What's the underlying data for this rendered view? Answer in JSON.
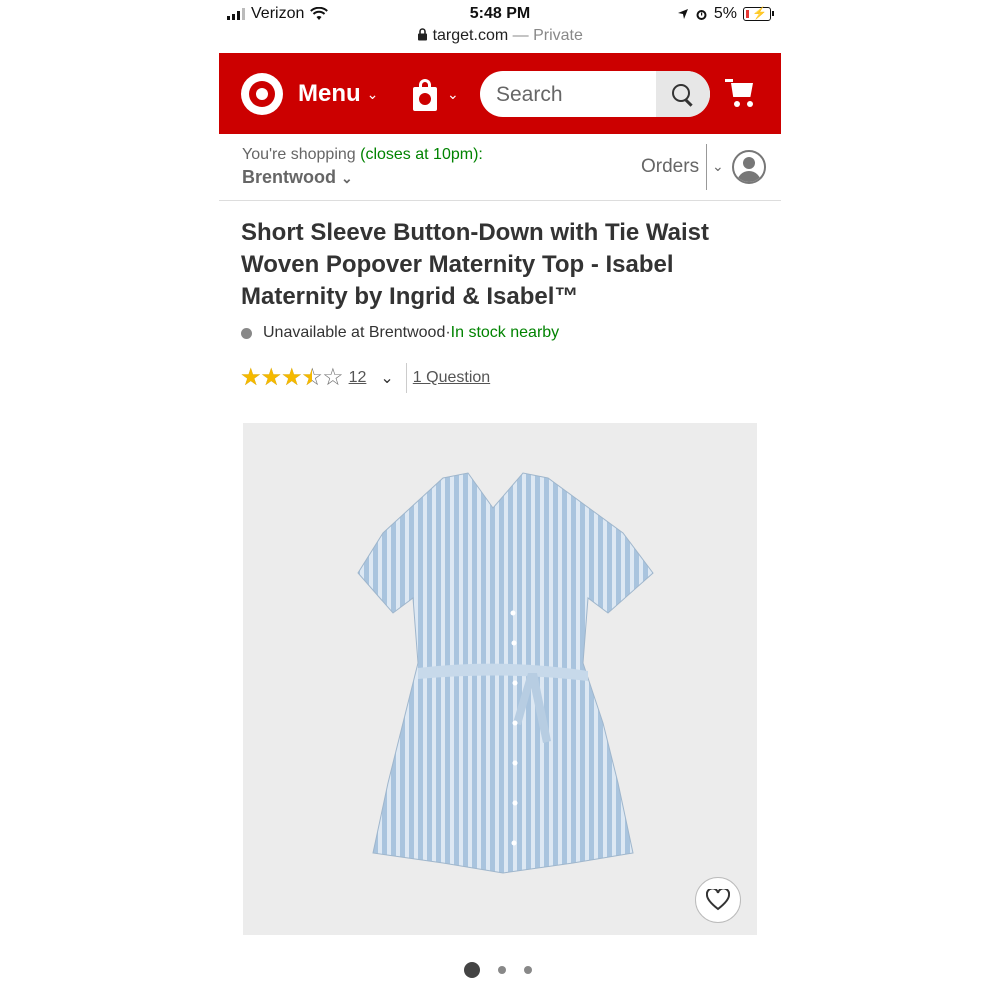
{
  "status_bar": {
    "carrier": "Verizon",
    "time": "5:48 PM",
    "battery": "5%",
    "url": "target.com",
    "private": "— Private"
  },
  "header": {
    "menu_label": "Menu",
    "search_placeholder": "Search",
    "brand_color": "#cc0000"
  },
  "shopping": {
    "prefix": "You're shopping ",
    "hours": "(closes at 10pm):",
    "store": "Brentwood",
    "orders_label": "Orders"
  },
  "product": {
    "title": "Short Sleeve Button-Down with Tie Waist Woven Popover Maternity Top - Isabel Maternity by Ingrid & Isabel™",
    "availability": "Unavailable at Brentwood",
    "separator": " · ",
    "stock_nearby": "In stock nearby",
    "rating": 3.5,
    "rating_max": 5,
    "review_count": "12",
    "questions_label": "1 Question"
  },
  "gallery": {
    "active_index": 0,
    "image_count": 3
  },
  "icons": [
    "signal-icon",
    "wifi-icon",
    "lock-icon",
    "location-icon",
    "alarm-icon",
    "battery-icon",
    "target-logo-icon",
    "chevron-down-icon",
    "shopping-bag-icon",
    "search-icon",
    "cart-icon",
    "account-icon",
    "star-icon",
    "heart-icon"
  ]
}
